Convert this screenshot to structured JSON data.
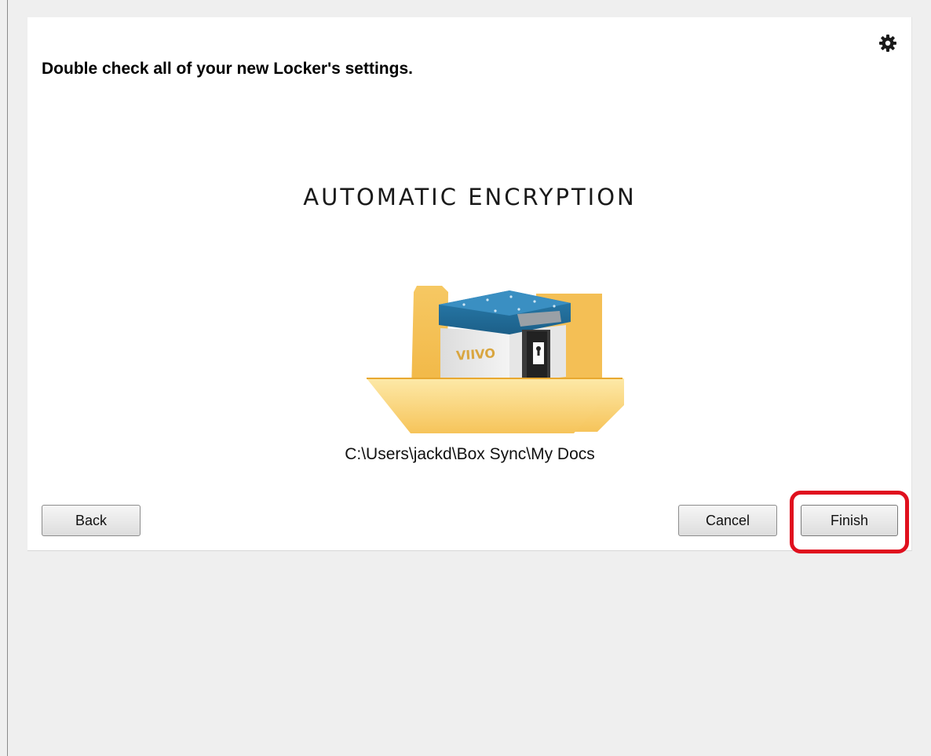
{
  "wizard": {
    "heading": "Double check all of your new Locker's settings.",
    "section_title": "AUTOMATIC ENCRYPTION",
    "folder_path": "C:\\Users\\jackd\\Box Sync\\My Docs",
    "settings_icon": "gear-icon",
    "illustration_icon": "locker-folder-icon"
  },
  "buttons": {
    "back_label": "Back",
    "cancel_label": "Cancel",
    "finish_label": "Finish"
  },
  "highlight": {
    "color": "#e0101e"
  }
}
